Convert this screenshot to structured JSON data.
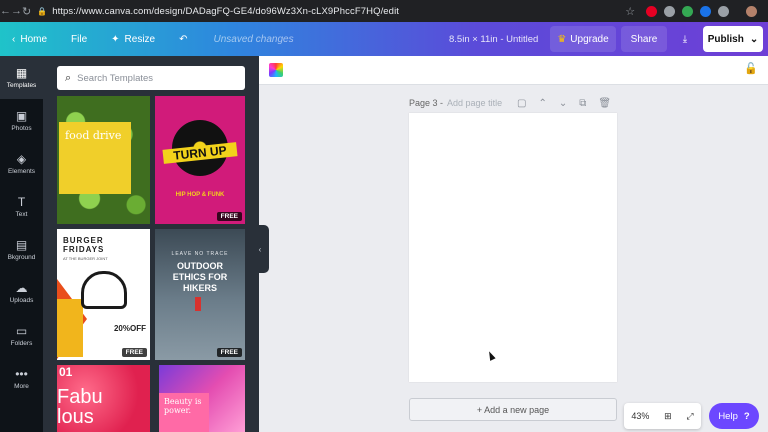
{
  "browser": {
    "url": "https://www.canva.com/design/DADagFQ-GE4/do96Wz3Xn-cLX9PhccF7HQ/edit"
  },
  "topbar": {
    "home": "Home",
    "file": "File",
    "resize": "Resize",
    "unsaved": "Unsaved changes",
    "doc_title": "8.5in × 11in - Untitled",
    "upgrade": "Upgrade",
    "share": "Share",
    "publish": "Publish"
  },
  "rail": [
    {
      "label": "Templates",
      "icon": "templates-icon"
    },
    {
      "label": "Photos",
      "icon": "photos-icon"
    },
    {
      "label": "Elements",
      "icon": "elements-icon"
    },
    {
      "label": "Text",
      "icon": "text-icon"
    },
    {
      "label": "Bkground",
      "icon": "background-icon"
    },
    {
      "label": "Uploads",
      "icon": "uploads-icon"
    },
    {
      "label": "Folders",
      "icon": "folders-icon"
    },
    {
      "label": "More",
      "icon": "more-icon"
    }
  ],
  "search": {
    "placeholder": "Search Templates"
  },
  "templates": {
    "t1": {
      "title": "food drive"
    },
    "t2": {
      "title": "TURN UP",
      "subtitle": "HIP HOP & FUNK",
      "badge": "FREE"
    },
    "t3": {
      "title": "BURGER FRIDAYS",
      "sub": "AT THE BURGER JOINT",
      "off": "20%OFF",
      "badge": "FREE"
    },
    "t4": {
      "lead": "LEAVE NO TRACE",
      "title": "OUTDOOR ETHICS FOR HIKERS",
      "badge": "FREE"
    },
    "t5": {
      "num": "01",
      "title": "Fabu lous"
    },
    "t6": {
      "title": "Beauty is power."
    }
  },
  "editor": {
    "page_label": "Page 3 -",
    "page_title_placeholder": "Add page title",
    "add_page": "+ Add a new page",
    "zoom": "43%",
    "help": "Help",
    "help_icon": "?"
  },
  "colors": {
    "brand_gradient_start": "#1fc3c9",
    "brand_gradient_end": "#6e3fd6",
    "rail_bg": "#0e1318",
    "panel_bg": "#293039",
    "help_bg": "#6c47ff"
  }
}
